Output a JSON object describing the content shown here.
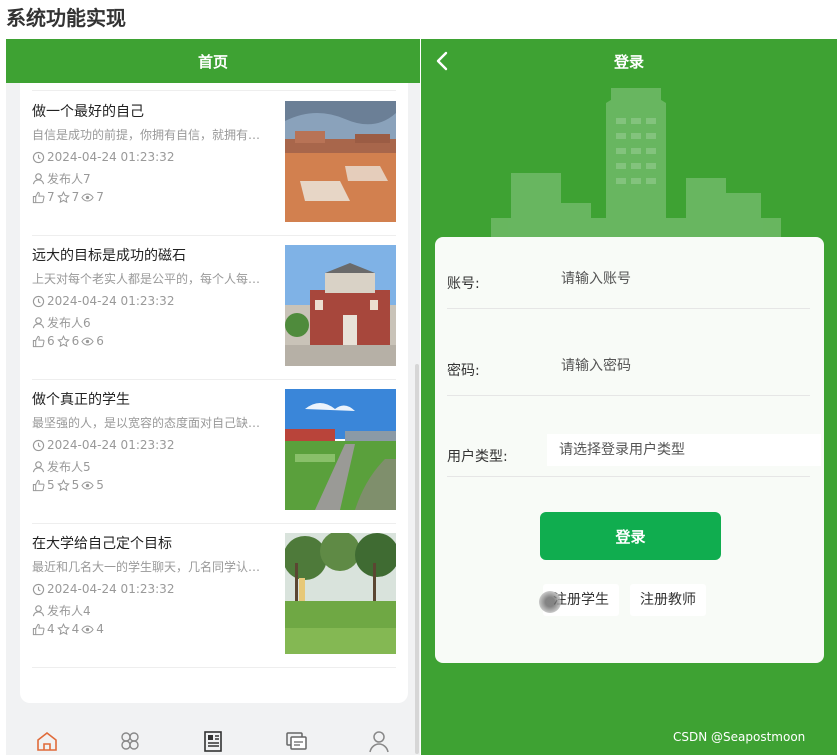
{
  "heading": "系统功能实现",
  "home": {
    "title": "首页",
    "items": [
      {
        "title": "做一个最好的自己",
        "desc": "自信是成功的前提，你拥有自信，就拥有…",
        "time": "2024-04-24 01:23:32",
        "publisher": "发布人7",
        "likes": "7",
        "favorites": "7",
        "views": "7"
      },
      {
        "title": "远大的目标是成功的磁石",
        "desc": "上天对每个老实人都是公平的，每个人每…",
        "time": "2024-04-24 01:23:32",
        "publisher": "发布人6",
        "likes": "6",
        "favorites": "6",
        "views": "6"
      },
      {
        "title": "做个真正的学生",
        "desc": "最坚强的人，是以宽容的态度面对自己缺…",
        "time": "2024-04-24 01:23:32",
        "publisher": "发布人5",
        "likes": "5",
        "favorites": "5",
        "views": "5"
      },
      {
        "title": "在大学给自己定个目标",
        "desc": "最近和几名大一的学生聊天，几名同学认…",
        "time": "2024-04-24 01:23:32",
        "publisher": "发布人4",
        "likes": "4",
        "favorites": "4",
        "views": "4"
      }
    ],
    "tabs": [
      "home-icon",
      "category-icon",
      "news-icon",
      "message-icon",
      "profile-icon"
    ]
  },
  "login": {
    "title": "登录",
    "account_label": "账号:",
    "account_placeholder": "请输入账号",
    "password_label": "密码:",
    "password_placeholder": "请输入密码",
    "usertype_label": "用户类型:",
    "usertype_placeholder": "请选择登录用户类型",
    "login_button": "登录",
    "register_student": "注册学生",
    "register_teacher": "注册教师"
  },
  "watermark": "CSDN @Seapostmoon",
  "colors": {
    "brand_green": "#3ea233",
    "button_green": "#10ad4f"
  }
}
